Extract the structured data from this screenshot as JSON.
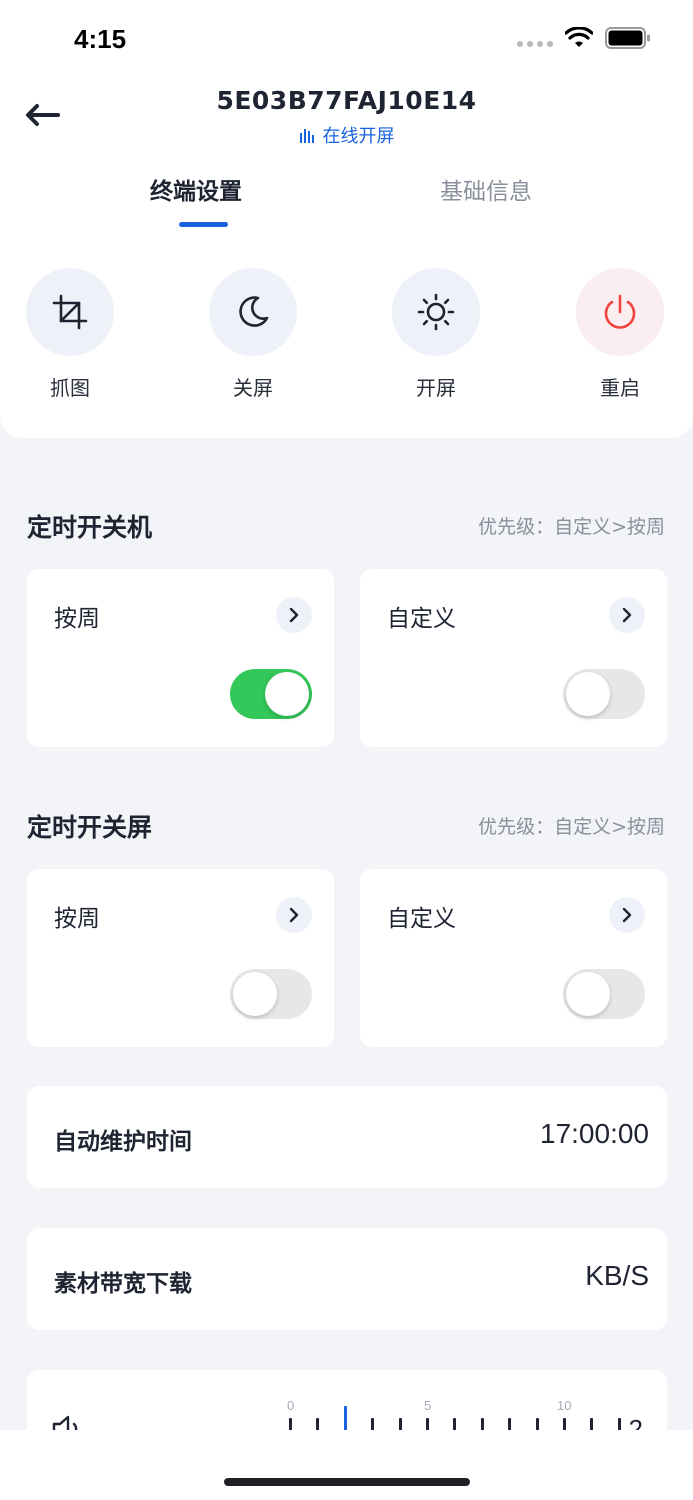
{
  "status_bar": {
    "time": "4:15"
  },
  "header": {
    "device_id": "5E03B77FAJ10E14",
    "status_text": "在线开屏",
    "accent_color": "#1a63e0"
  },
  "tabs": [
    {
      "label": "终端设置",
      "active": true
    },
    {
      "label": "基础信息",
      "active": false
    }
  ],
  "actions": [
    {
      "label": "抓图",
      "icon": "crop-icon"
    },
    {
      "label": "关屏",
      "icon": "moon-icon"
    },
    {
      "label": "开屏",
      "icon": "sun-icon"
    },
    {
      "label": "重启",
      "icon": "power-icon"
    }
  ],
  "sections": [
    {
      "title": "定时开关机",
      "hint": "优先级：自定义>按周",
      "cards": [
        {
          "label": "按周",
          "enabled": true
        },
        {
          "label": "自定义",
          "enabled": false
        }
      ]
    },
    {
      "title": "定时开关屏",
      "hint": "优先级：自定义>按周",
      "cards": [
        {
          "label": "按周",
          "enabled": false
        },
        {
          "label": "自定义",
          "enabled": false
        }
      ]
    }
  ],
  "rows": [
    {
      "label": "自动维护时间",
      "value": "17:00:00"
    },
    {
      "label": "素材带宽下载",
      "value": "KB/S"
    }
  ],
  "volume": {
    "tick_labels": [
      "0",
      "5",
      "10"
    ],
    "value": "2",
    "scale_max": 12
  }
}
